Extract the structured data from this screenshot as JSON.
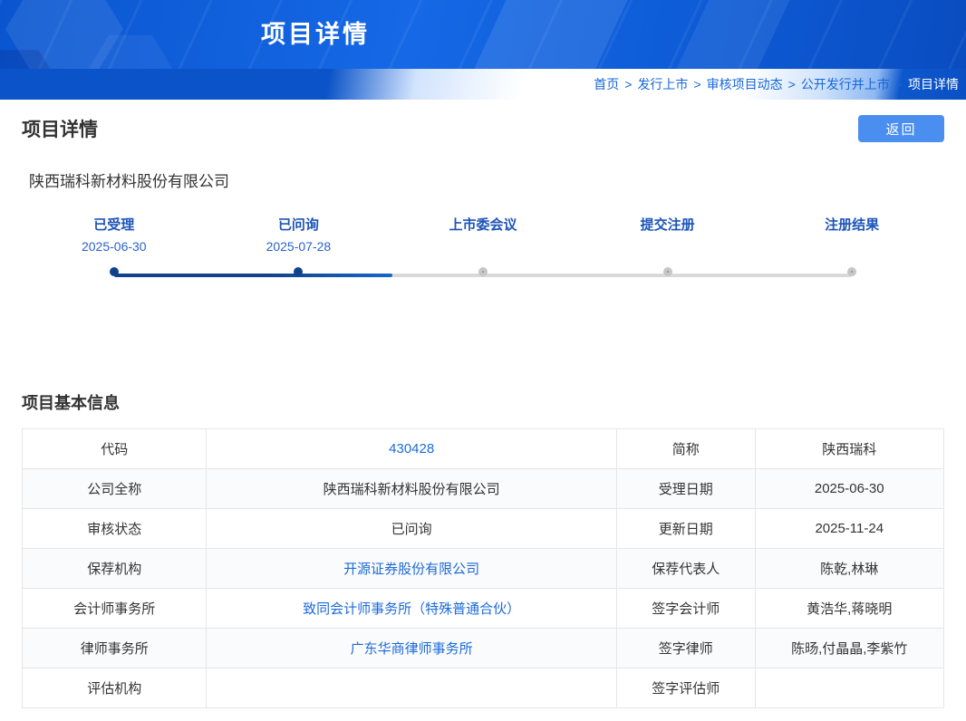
{
  "banner": {
    "title": "项目详情"
  },
  "breadcrumb": {
    "separator": ">",
    "items": [
      "首页",
      "发行上市",
      "审核项目动态",
      "公开发行并上市",
      "项目详情"
    ]
  },
  "page": {
    "title": "项目详情",
    "back_button": "返回",
    "company_name": "陕西瑞科新材料股份有限公司"
  },
  "timeline": {
    "progress_percent": 37.7,
    "steps": [
      {
        "label": "已受理",
        "date": "2025-06-30",
        "state": "done"
      },
      {
        "label": "已问询",
        "date": "2025-07-28",
        "state": "done"
      },
      {
        "label": "上市委会议",
        "date": "",
        "state": "pending"
      },
      {
        "label": "提交注册",
        "date": "",
        "state": "pending"
      },
      {
        "label": "注册结果",
        "date": "",
        "state": "pending"
      }
    ]
  },
  "basic_info": {
    "section_title": "项目基本信息",
    "rows": [
      {
        "cells": [
          {
            "text": "代码",
            "type": "label"
          },
          {
            "text": "430428",
            "type": "value",
            "blue": true,
            "clickable": false
          },
          {
            "text": "简称",
            "type": "label"
          },
          {
            "text": "陕西瑞科",
            "type": "value"
          }
        ]
      },
      {
        "cells": [
          {
            "text": "公司全称",
            "type": "label"
          },
          {
            "text": "陕西瑞科新材料股份有限公司",
            "type": "value"
          },
          {
            "text": "受理日期",
            "type": "label"
          },
          {
            "text": "2025-06-30",
            "type": "value"
          }
        ]
      },
      {
        "cells": [
          {
            "text": "审核状态",
            "type": "label"
          },
          {
            "text": "已问询",
            "type": "value"
          },
          {
            "text": "更新日期",
            "type": "label"
          },
          {
            "text": "2025-11-24",
            "type": "value"
          }
        ]
      },
      {
        "cells": [
          {
            "text": "保荐机构",
            "type": "label"
          },
          {
            "text": "开源证券股份有限公司",
            "type": "value",
            "blue": true,
            "clickable": true
          },
          {
            "text": "保荐代表人",
            "type": "label"
          },
          {
            "text": "陈乾,林琳",
            "type": "value"
          }
        ]
      },
      {
        "cells": [
          {
            "text": "会计师事务所",
            "type": "label"
          },
          {
            "text": "致同会计师事务所（特殊普通合伙）",
            "type": "value",
            "blue": true,
            "clickable": true
          },
          {
            "text": "签字会计师",
            "type": "label"
          },
          {
            "text": "黄浩华,蒋晓明",
            "type": "value"
          }
        ]
      },
      {
        "cells": [
          {
            "text": "律师事务所",
            "type": "label"
          },
          {
            "text": "广东华商律师事务所",
            "type": "value",
            "blue": true,
            "clickable": true
          },
          {
            "text": "签字律师",
            "type": "label"
          },
          {
            "text": "陈旸,付晶晶,李紫竹",
            "type": "value"
          }
        ]
      },
      {
        "cells": [
          {
            "text": "评估机构",
            "type": "label"
          },
          {
            "text": "",
            "type": "value"
          },
          {
            "text": "签字评估师",
            "type": "label"
          },
          {
            "text": "",
            "type": "value"
          }
        ]
      }
    ]
  },
  "colors": {
    "banner_blue": "#1668e6",
    "accent_blue": "#1668d9",
    "navy": "#12428c",
    "button_blue": "#4a8ff0",
    "link_blue": "#1d6ad8",
    "pending_gray": "#8f8f8f"
  }
}
